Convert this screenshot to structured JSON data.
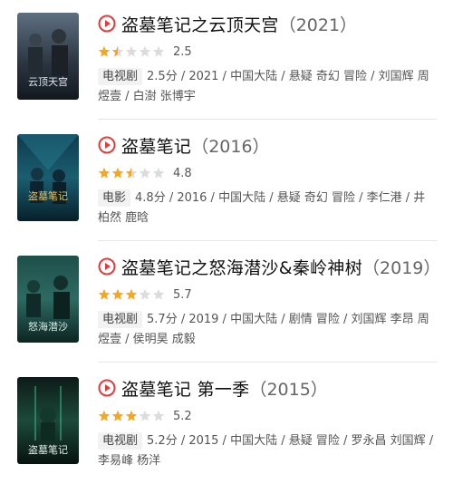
{
  "colors": {
    "accent": "#e03c3c",
    "star_on": "#f5a623",
    "star_off": "#dcdcdc"
  },
  "items": [
    {
      "title": "盗墓笔记之云顶天宫",
      "year": "（2021）",
      "stars": 1.5,
      "score": "2.5",
      "badge": "电视剧",
      "meta": "2.5分 / 2021 / 中国大陆 / 悬疑 奇幻 冒险 / 刘国辉 周煜壹 / 白澍 张博宇",
      "poster_text": "云顶天宫"
    },
    {
      "title": "盗墓笔记",
      "year": "（2016）",
      "stars": 2.5,
      "score": "4.8",
      "badge": "电影",
      "meta": "4.8分 / 2016 / 中国大陆 / 悬疑 奇幻 冒险 / 李仁港 / 井柏然 鹿晗",
      "poster_text": "盗墓笔记"
    },
    {
      "title": "盗墓笔记之怒海潜沙&秦岭神树",
      "year": "（2019）",
      "stars": 3,
      "score": "5.7",
      "badge": "电视剧",
      "meta": "5.7分 / 2019 / 中国大陆 / 剧情 冒险 / 刘国辉 李昂 周煜壹 / 侯明昊 成毅",
      "poster_text": "怒海潜沙"
    },
    {
      "title": "盗墓笔记 第一季",
      "year": "（2015）",
      "stars": 3,
      "score": "5.2",
      "badge": "电视剧",
      "meta": "5.2分 / 2015 / 中国大陆 / 悬疑 冒险 / 罗永昌 刘国辉 / 李易峰 杨洋",
      "poster_text": "盗墓笔记"
    }
  ]
}
